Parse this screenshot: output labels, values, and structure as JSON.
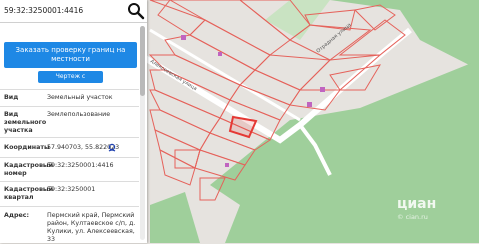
{
  "search": {
    "value": "59:32:3250001:4416"
  },
  "actions": {
    "order_check_label": "Заказать проверку границ на местности",
    "dims_label": "Чертеж с размерами"
  },
  "info": {
    "type": {
      "label": "Вид",
      "value": "Земельный участок"
    },
    "land_use": {
      "label": "Вид земельного участка",
      "value": "Землепользование"
    },
    "coords": {
      "label": "Координаты",
      "value": "57.940703, 55.822023"
    },
    "cad_number": {
      "label": "Кадастровый номер",
      "value": "59:32:3250001:4416"
    },
    "cad_quarter": {
      "label": "Кадастровый квартал",
      "value": "59:32:3250001"
    },
    "address": {
      "label": "Адрес:",
      "value": "Пермский край, Пермский район, Култаевское с/п, д. Кулики, ул. Алексеевская, 33"
    }
  },
  "map": {
    "street_label_1": "Алексеевская улица",
    "street_label_2": "Отрадная улица",
    "watermark": "циан",
    "watermark_sub": "© cian.ru"
  },
  "icons": {
    "search": "search-icon",
    "location": "location-pin-icon"
  },
  "colors": {
    "accent": "#1e88e5",
    "parcel_border": "#e5625b",
    "selected_parcel": "#e53935",
    "forest": "#9fcf9b",
    "field": "#e6e3df",
    "building": "#c064c0"
  }
}
